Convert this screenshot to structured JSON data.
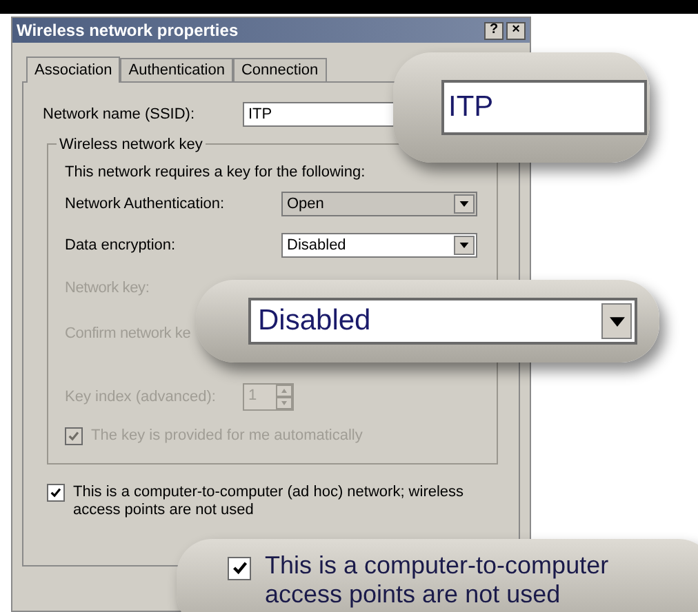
{
  "window": {
    "title": "Wireless network properties",
    "title_buttons": [
      "?",
      "×"
    ]
  },
  "tabs": [
    {
      "label": "Association",
      "selected": true
    },
    {
      "label": "Authentication",
      "selected": false
    },
    {
      "label": "Connection",
      "selected": false
    }
  ],
  "ssid": {
    "label": "Network name (SSID):",
    "value": "ITP"
  },
  "key_group": {
    "title": "Wireless network key",
    "intro": "This network requires a key for the following:",
    "rows": [
      {
        "kind": "dropdown",
        "label": "Network Authentication:",
        "value": "Open",
        "disabled": false,
        "readonly": true
      },
      {
        "kind": "dropdown",
        "label": "Data encryption:",
        "value": "Disabled",
        "disabled": false,
        "readonly": false
      },
      {
        "kind": "label",
        "label": "Network key:",
        "disabled": true
      },
      {
        "kind": "label",
        "label": "Confirm network ke",
        "disabled": true
      },
      {
        "kind": "spinner",
        "label": "Key index (advanced):",
        "value": "1",
        "disabled": true
      },
      {
        "kind": "checkbox",
        "label": "The key is provided for me automatically",
        "checked": true,
        "disabled": true
      }
    ]
  },
  "adhoc": {
    "lines": [
      "This is a computer-to-computer (ad hoc) network; wireless",
      "access points are not used"
    ],
    "checked": true
  },
  "callouts": [
    {
      "kind": "text_field",
      "value": "ITP"
    },
    {
      "kind": "dropdown",
      "value": "Disabled"
    },
    {
      "kind": "checkbox",
      "checked": true,
      "lines": [
        "This is a computer-to-computer",
        "access points are not used"
      ]
    }
  ]
}
